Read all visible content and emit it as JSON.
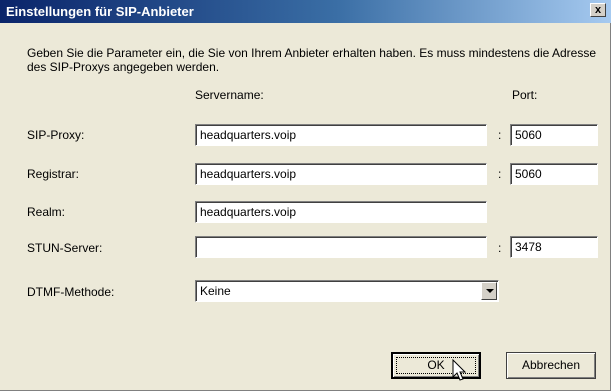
{
  "window": {
    "title": "Einstellungen für SIP-Anbieter",
    "close_label": "x"
  },
  "description": "Geben Sie die Parameter ein, die Sie von Ihrem Anbieter erhalten haben. Es muss mindestens die Adresse des SIP-Proxys angegeben werden.",
  "headers": {
    "servername": "Servername:",
    "port": "Port:"
  },
  "fields": {
    "sip_proxy": {
      "label": "SIP-Proxy:",
      "server": "headquarters.voip",
      "port": "5060"
    },
    "registrar": {
      "label": "Registrar:",
      "server": "headquarters.voip",
      "port": "5060"
    },
    "realm": {
      "label": "Realm:",
      "server": "headquarters.voip"
    },
    "stun": {
      "label": "STUN-Server:",
      "server": "",
      "port": "3478"
    },
    "dtmf": {
      "label": "DTMF-Methode:",
      "value": "Keine"
    }
  },
  "colon": ":",
  "buttons": {
    "ok": "OK",
    "cancel": "Abbrechen"
  },
  "icons": {
    "close": "close-icon",
    "dropdown": "chevron-down-icon",
    "cursor": "mouse-pointer-icon"
  }
}
